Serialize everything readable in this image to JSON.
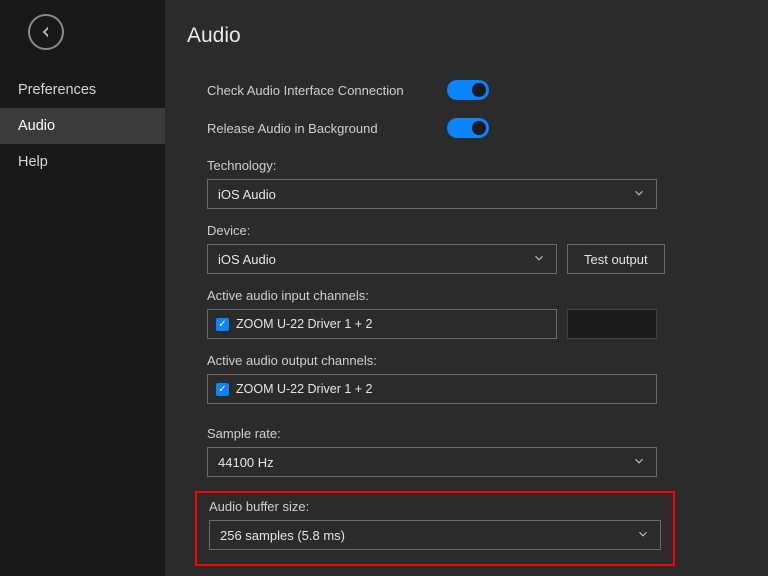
{
  "page": {
    "title": "Audio"
  },
  "sidebar": {
    "items": {
      "0": {
        "label": "Preferences"
      },
      "1": {
        "label": "Audio"
      },
      "2": {
        "label": "Help"
      }
    }
  },
  "toggles": {
    "check_interface": "Check Audio Interface Connection",
    "release_bg": "Release Audio in Background"
  },
  "tech": {
    "label": "Technology:",
    "value": "iOS Audio"
  },
  "device": {
    "label": "Device:",
    "value": "iOS Audio",
    "test_btn": "Test output"
  },
  "input_ch": {
    "label": "Active audio input channels:",
    "value": "ZOOM U-22 Driver 1 + 2"
  },
  "output_ch": {
    "label": "Active audio output channels:",
    "value": "ZOOM U-22 Driver 1 + 2"
  },
  "sample_rate": {
    "label": "Sample rate:",
    "value": "44100 Hz"
  },
  "buffer": {
    "label": "Audio buffer size:",
    "value": "256 samples (5.8 ms)"
  }
}
